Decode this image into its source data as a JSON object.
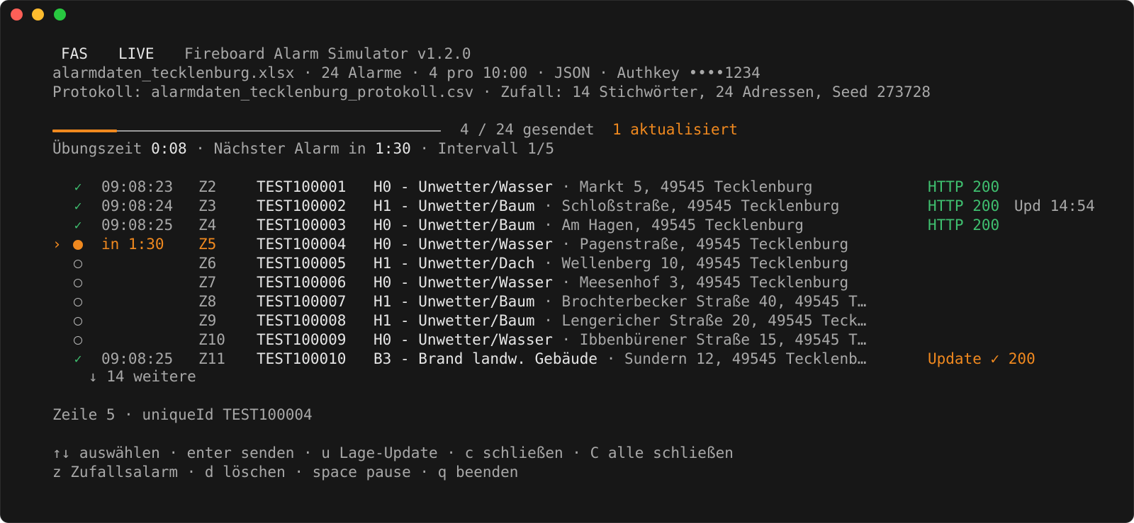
{
  "header": {
    "badge_app": "FAS",
    "badge_mode": "LIVE",
    "app_title": "Fireboard Alarm Simulator v1.2.0",
    "info_line": "alarmdaten_tecklenburg.xlsx · 24 Alarme · 4 pro 10:00 · JSON · Authkey ••••1234",
    "protocol_line": "Protokoll: alarmdaten_tecklenburg_protokoll.csv · Zufall: 14 Stichwörter, 24 Adressen, Seed 273728"
  },
  "progress": {
    "fraction": 0.1667,
    "sent_text": "4 / 24 gesendet",
    "updated_text": "1 aktualisiert"
  },
  "timing": {
    "exercise_label": "Übungszeit ",
    "exercise_value": "0:08",
    "next_label": " · Nächster Alarm in ",
    "next_value": "1:30",
    "interval_text": " · Intervall 1/5"
  },
  "alarms": [
    {
      "marker": "",
      "state": "sent",
      "icon": "check-icon",
      "time": "09:08:23",
      "zone": "Z2",
      "uid": "TEST100001",
      "keyword": "H0 - Unwetter/Wasser",
      "address": " · Markt 5, 49545 Tecklenburg",
      "status": "HTTP 200",
      "update": ""
    },
    {
      "marker": "",
      "state": "sent",
      "icon": "check-icon",
      "time": "09:08:24",
      "zone": "Z3",
      "uid": "TEST100002",
      "keyword": "H1 - Unwetter/Baum",
      "address": " · Schloßstraße, 49545 Tecklenburg",
      "status": "HTTP 200",
      "update": "Upd 14:54"
    },
    {
      "marker": "",
      "state": "sent",
      "icon": "check-icon",
      "time": "09:08:25",
      "zone": "Z4",
      "uid": "TEST100003",
      "keyword": "H0 - Unwetter/Baum",
      "address": " · Am Hagen, 49545 Tecklenburg",
      "status": "HTTP 200",
      "update": ""
    },
    {
      "marker": "›",
      "state": "next",
      "icon": "filled-dot-icon",
      "time": "in 1:30",
      "zone": "Z5",
      "uid": "TEST100004",
      "keyword": "H0 - Unwetter/Wasser",
      "address": " · Pagenstraße, 49545 Tecklenburg",
      "status": "",
      "update": ""
    },
    {
      "marker": "",
      "state": "pending",
      "icon": "empty-circle-icon",
      "time": "",
      "zone": "Z6",
      "uid": "TEST100005",
      "keyword": "H1 - Unwetter/Dach",
      "address": " · Wellenberg 10, 49545 Tecklenburg",
      "status": "",
      "update": ""
    },
    {
      "marker": "",
      "state": "pending",
      "icon": "empty-circle-icon",
      "time": "",
      "zone": "Z7",
      "uid": "TEST100006",
      "keyword": "H0 - Unwetter/Wasser",
      "address": " · Meesenhof 3, 49545 Tecklenburg",
      "status": "",
      "update": ""
    },
    {
      "marker": "",
      "state": "pending",
      "icon": "empty-circle-icon",
      "time": "",
      "zone": "Z8",
      "uid": "TEST100007",
      "keyword": "H1 - Unwetter/Baum",
      "address": " · Brochterbecker Straße 40, 49545 T…",
      "status": "",
      "update": ""
    },
    {
      "marker": "",
      "state": "pending",
      "icon": "empty-circle-icon",
      "time": "",
      "zone": "Z9",
      "uid": "TEST100008",
      "keyword": "H1 - Unwetter/Baum",
      "address": " · Lengericher Straße 20, 49545 Teck…",
      "status": "",
      "update": ""
    },
    {
      "marker": "",
      "state": "pending",
      "icon": "empty-circle-icon",
      "time": "",
      "zone": "Z10",
      "uid": "TEST100009",
      "keyword": "H0 - Unwetter/Wasser",
      "address": " · Ibbenbürener Straße 15, 49545 T…",
      "status": "",
      "update": ""
    },
    {
      "marker": "",
      "state": "updated",
      "icon": "check-icon",
      "time": "09:08:25",
      "zone": "Z11",
      "uid": "TEST100010",
      "keyword": "B3 - Brand landw. Gebäude",
      "address": " · Sundern 12, 49545 Tecklenb…",
      "status": "Update ✓ 200",
      "update": ""
    }
  ],
  "more_text": "↓ 14 weitere",
  "selection_text": "Zeile 5 · uniqueId TEST100004",
  "help": {
    "line1": "↑↓ auswählen · enter senden · u Lage-Update · c schließen · C alle schließen",
    "line2": "z Zufallsalarm · d löschen · space pause · q beenden"
  },
  "colors": {
    "background": "#171717",
    "text": "#a8a8a8",
    "bright": "#e6e6e6",
    "accent": "#f0891f",
    "success": "#3fbf6f"
  }
}
